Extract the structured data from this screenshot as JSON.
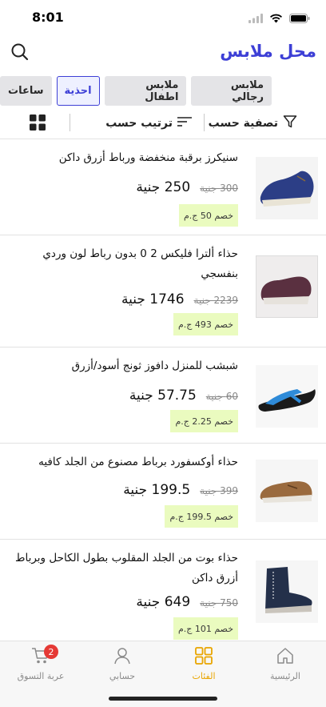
{
  "status": {
    "time": "8:01"
  },
  "header": {
    "title": "محل ملابس"
  },
  "categories": [
    {
      "label": "ملابس رجالي",
      "active": false
    },
    {
      "label": "ملابس اطفال",
      "active": false
    },
    {
      "label": "احذية",
      "active": true
    },
    {
      "label": "ساعات",
      "active": false
    }
  ],
  "toolbar": {
    "filter_label": "تصفية حسب",
    "sort_label": "ترتيب حسب"
  },
  "products": [
    {
      "name": "سنيكرز برقبة منخفضة ورباط أزرق داكن",
      "price": "250 جنية",
      "old_price": "300 جنية",
      "discount": "خصم 50 ج.م"
    },
    {
      "name": "حذاء ألترا فليكس 2 0 بدون رباط لون وردي بنفسجي",
      "price": "1746 جنية",
      "old_price": "2239 جنية",
      "discount": "خصم 493 ج.م"
    },
    {
      "name": "شبشب للمنزل دافوز ثونج أسود/أزرق",
      "price": "57.75 جنية",
      "old_price": "60 جنية",
      "discount": "خصم 2.25 ج.م"
    },
    {
      "name": "حذاء أوكسفورد برباط مصنوع من الجلد كافيه",
      "price": "199.5 جنية",
      "old_price": "399 جنية",
      "discount": "خصم 199.5 ج.م"
    },
    {
      "name": "حذاء بوت من الجلد المقلوب بطول الكاحل وبرباط أزرق داكن",
      "price": "649 جنية",
      "old_price": "750 جنية",
      "discount": "خصم 101 ج.م"
    }
  ],
  "tabs": [
    {
      "label": "الرئيسية",
      "icon": "home-icon",
      "active": false
    },
    {
      "label": "الفئات",
      "icon": "grid-icon",
      "active": true
    },
    {
      "label": "حسابي",
      "icon": "user-icon",
      "active": false
    },
    {
      "label": "عربة التسوق",
      "icon": "cart-icon",
      "active": false,
      "badge": "2"
    }
  ],
  "colors": {
    "brand": "#3d3fd6",
    "active_tab": "#e9a500",
    "discount_bg": "#eafbbf",
    "badge": "#e53935"
  }
}
